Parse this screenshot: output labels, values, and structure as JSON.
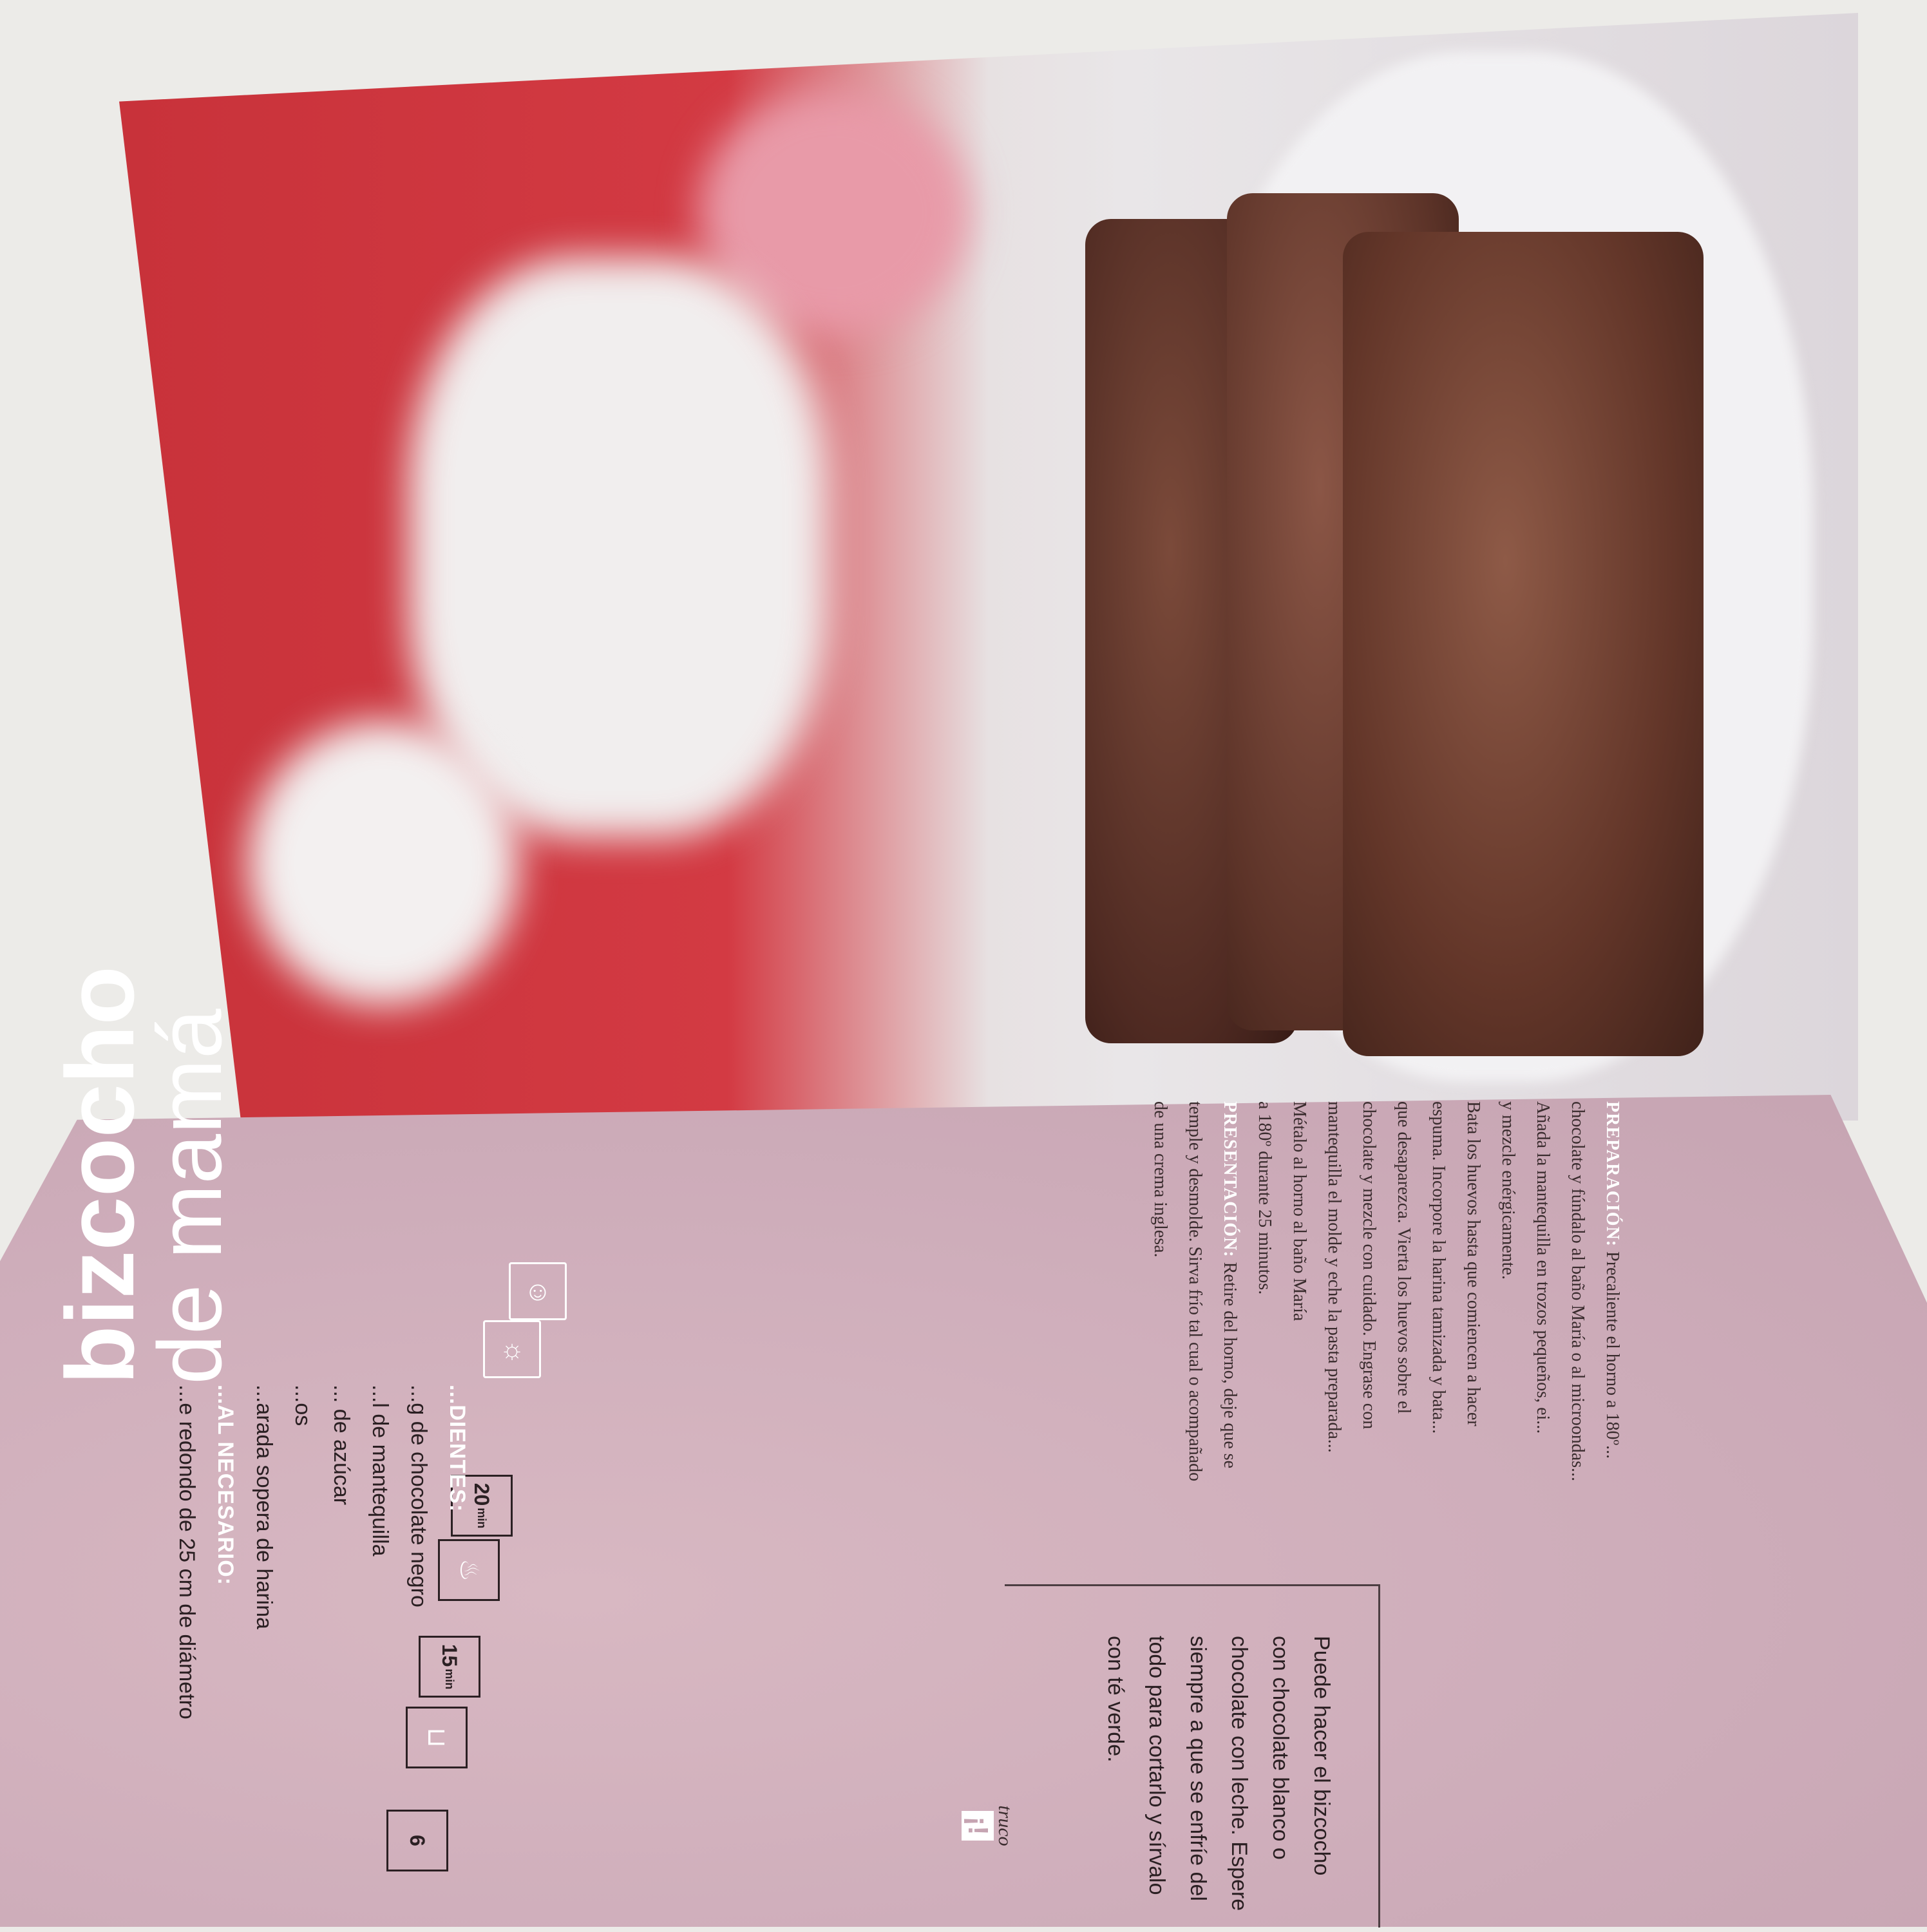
{
  "recipe": {
    "title_main": "bizcocho",
    "title_sub": "de mamá",
    "stats": {
      "servings": "6",
      "prep_time": "15",
      "prep_unit": "min",
      "cook_time": "20",
      "cook_unit": "min"
    },
    "ingredients_label": "...dientes:",
    "ingredients": [
      "...g de chocolate negro",
      "...l de mantequilla",
      "... de azúcar",
      "...os",
      "...arada sopera de harina"
    ],
    "equipment_label": "...al necesario:",
    "equipment": "...e redondo de 25 cm de diámetro",
    "preparation_label": "PREPARACIÓN:",
    "preparation_lines": [
      "Precaliente el horno a 180º...",
      "chocolate y fúndalo al baño María o al microondas...",
      "Añada la mantequilla en trozos pequeños, ei...",
      "y mezcle enérgicamente.",
      "Bata los huevos hasta que comiencen a hacer",
      "espuma. Incorpore la harina tamizada y bata...",
      "que desaparezca. Vierta los huevos sobre el",
      "chocolate y mezcle con cuidado. Engrase con",
      "mantequilla el molde y eche la pasta preparada...",
      "Métalo al horno al baño María",
      "a 180º durante 25 minutos."
    ],
    "presentation_label": "PRESENTACIÓN:",
    "presentation_lines": [
      "Retire del horno, deje que se",
      "temple y desmolde. Sirva frío tal cual o acompañado",
      "de una crema inglesa."
    ],
    "trick": {
      "badge_label": "truco",
      "badge_bang": "¡!",
      "lines": [
        "Puede hacer el bizcocho",
        "con chocolate blanco o",
        "chocolate con leche. Espere",
        "siempre a que se enfríe del",
        "todo para cortarlo y sírvalo",
        "con té verde."
      ]
    }
  },
  "colors": {
    "page_pink": "#cfaebb",
    "photo_red": "#c8323a",
    "cake_brown": "#5c3328"
  }
}
